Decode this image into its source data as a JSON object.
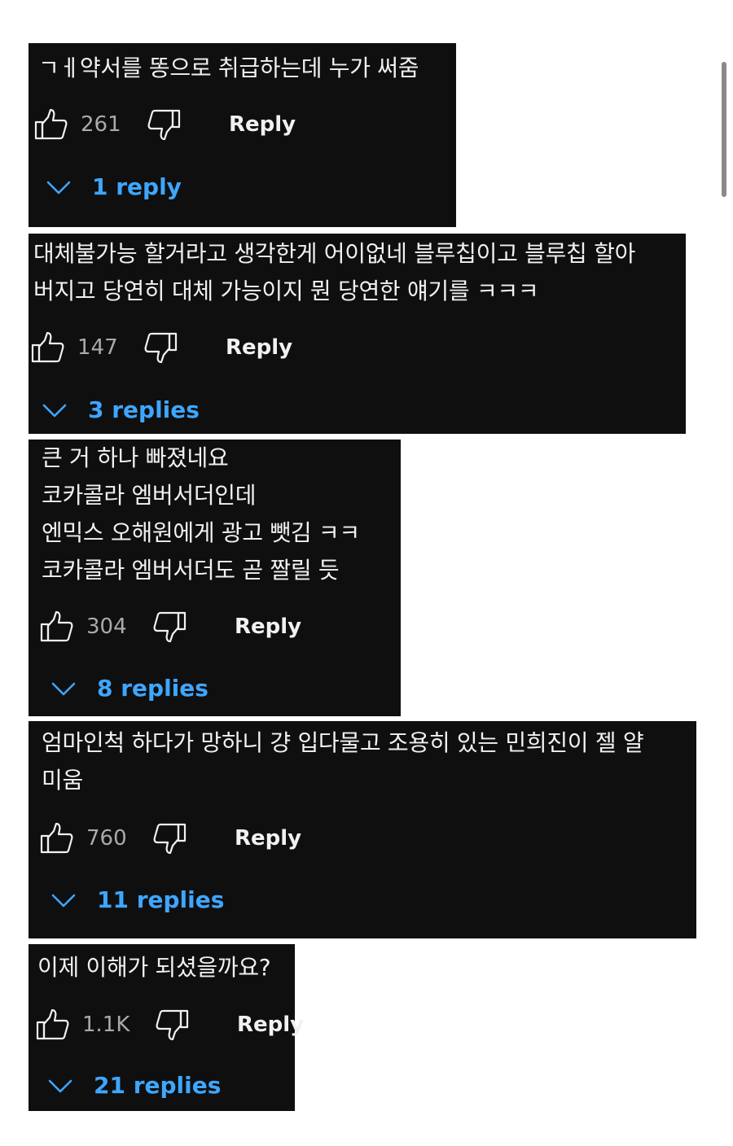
{
  "comments": [
    {
      "text": "ㄱㅔ약서를 똥으로 취급하는데 누가 써줌",
      "likes": "261",
      "reply_label": "Reply",
      "replies_label": "1 reply"
    },
    {
      "text": "대체불가능 할거라고 생각한게 어이없네 블루칩이고 블루칩 할아\n버지고 당연히 대체 가능이지 뭔 당연한 얘기를 ㅋㅋㅋ",
      "likes": "147",
      "reply_label": "Reply",
      "replies_label": "3 replies"
    },
    {
      "text": "큰 거 하나 빠졌네요\n코카콜라 엠버서더인데\n엔믹스 오해원에게 광고 뺏김 ㅋㅋ\n코카콜라 엠버서더도 곧 짤릴 듯",
      "likes": "304",
      "reply_label": "Reply",
      "replies_label": "8 replies"
    },
    {
      "text": "엄마인척 하다가 망하니 걍 입다물고 조용히 있는 민희진이 젤 얄\n미움",
      "likes": "760",
      "reply_label": "Reply",
      "replies_label": "11 replies"
    },
    {
      "text": "이제 이해가 되셨을까요?",
      "likes": "1.1K",
      "reply_label": "Reply",
      "replies_label": "21 replies"
    }
  ],
  "icons": {
    "like": "thumbs-up-icon",
    "dislike": "thumbs-down-icon",
    "expand": "chevron-down-icon"
  },
  "colors": {
    "card_background": "#0f0f0f",
    "text": "#f1f1f1",
    "count": "#aaaaaa",
    "replies_link": "#3ea6ff"
  }
}
